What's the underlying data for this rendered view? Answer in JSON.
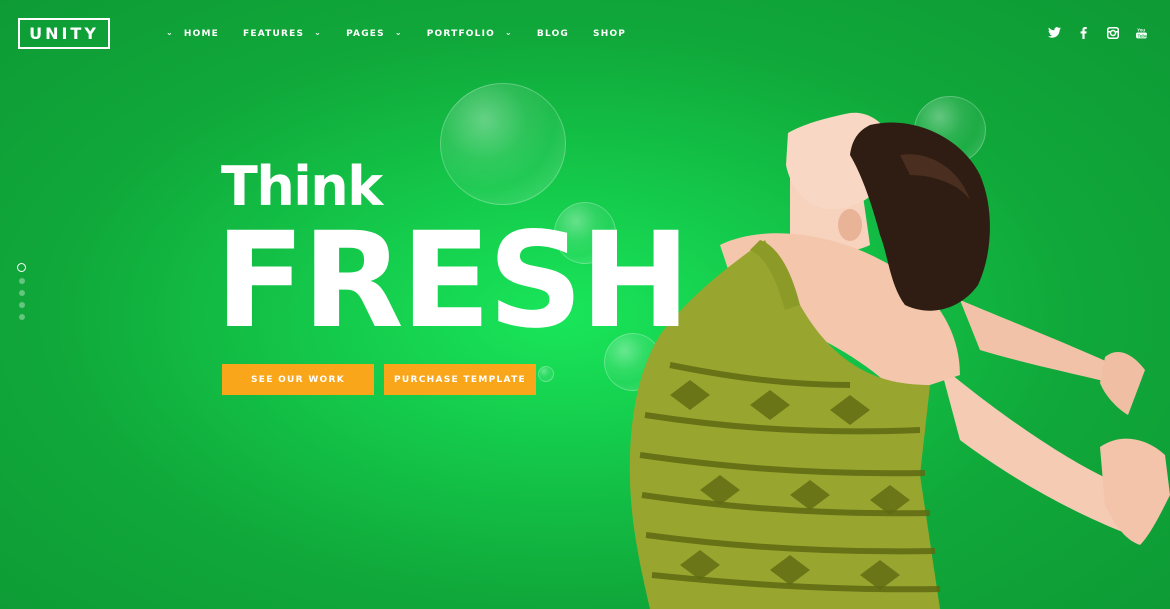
{
  "brand": {
    "logo_text": "UNITY"
  },
  "nav": {
    "items": [
      {
        "label": "HOME",
        "has_dropdown": true
      },
      {
        "label": "FEATURES",
        "has_dropdown": true
      },
      {
        "label": "PAGES",
        "has_dropdown": true
      },
      {
        "label": "PORTFOLIO",
        "has_dropdown": true
      },
      {
        "label": "BLOG",
        "has_dropdown": false
      },
      {
        "label": "SHOP",
        "has_dropdown": false
      }
    ],
    "dropdown_icon": "chevron-down-icon"
  },
  "social": [
    "twitter-icon",
    "facebook-icon",
    "instagram-icon",
    "youtube-icon"
  ],
  "slider": {
    "slide_count": 5,
    "active_index": 0
  },
  "hero": {
    "line1": "Think",
    "line2": "FRESH",
    "buttons": {
      "primary_label": "SEE OUR WORK",
      "secondary_label": "PURCHASE TEMPLATE"
    }
  },
  "colors": {
    "background": "#14c84a",
    "accent": "#f9a61b",
    "text": "#ffffff"
  }
}
